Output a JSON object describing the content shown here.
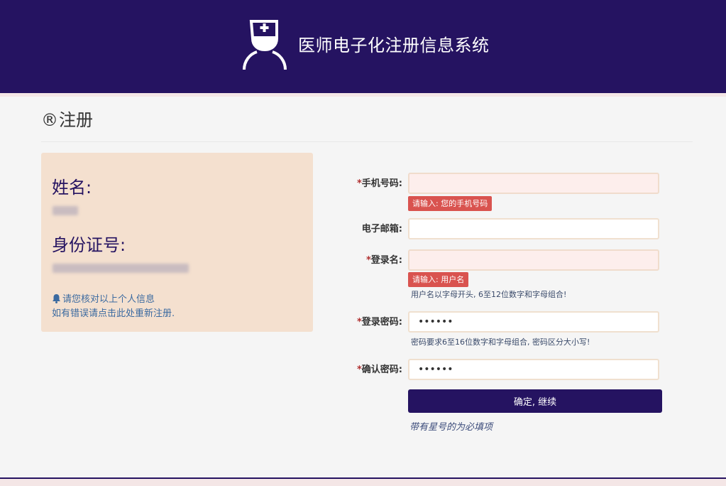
{
  "header": {
    "title": "医师电子化注册信息系统",
    "logo_icon": "nurse-icon"
  },
  "page": {
    "heading_icon": "®",
    "heading": "注册"
  },
  "info_card": {
    "name_label": "姓名:",
    "id_label": "身份证号:",
    "notice_line1": "请您核对以上个人信息",
    "notice_line2": "如有错误请点击此处重新注册.",
    "notice_icon": "bell-icon"
  },
  "form": {
    "phone": {
      "label": "手机号码:",
      "required": "*",
      "value": "",
      "error": "请输入: 您的手机号码"
    },
    "email": {
      "label": "电子邮箱:",
      "value": ""
    },
    "username": {
      "label": "登录名:",
      "required": "*",
      "value": "",
      "error": "请输入: 用户名",
      "hint": "用户名以字母开头, 6至12位数字和字母组合!"
    },
    "password": {
      "label": "登录密码:",
      "required": "*",
      "value": "••••••",
      "hint": "密码要求6至16位数字和字母组合, 密码区分大小写!"
    },
    "confirm_password": {
      "label": "确认密码:",
      "required": "*",
      "value": "••••••"
    },
    "submit_label": "确定, 继续",
    "required_note": "带有星号的为必填项"
  },
  "colors": {
    "primary": "#251361",
    "card_bg": "#f4e0cf",
    "error": "#d9534f",
    "link": "#3b6aa0"
  }
}
